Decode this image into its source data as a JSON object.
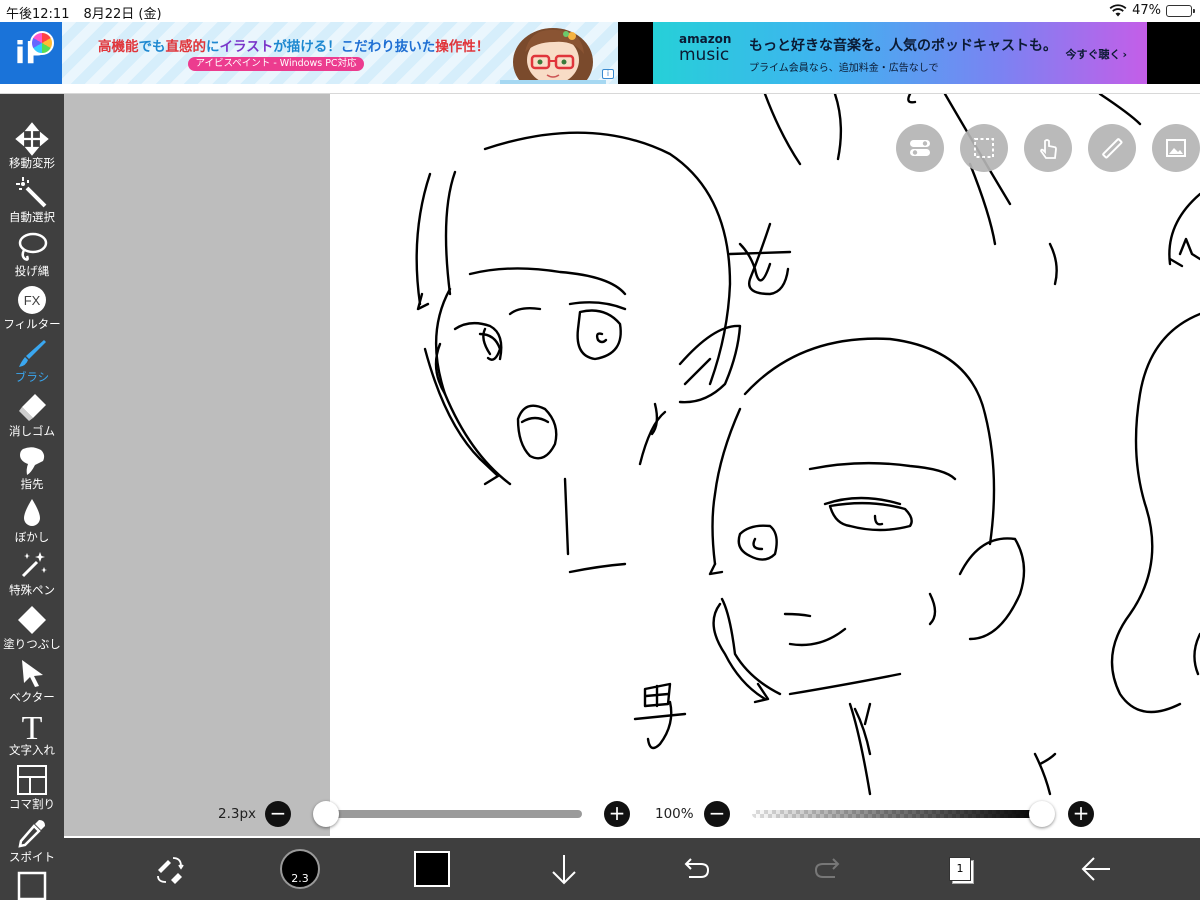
{
  "status_bar": {
    "time": "午後12:11",
    "date": "8月22日 (金)",
    "battery": "47%",
    "battery_level": 0.47
  },
  "ads": {
    "ibis": {
      "headline_parts": [
        "高機能",
        "でも",
        "直感的",
        "に",
        "イラスト",
        "が描ける！",
        "こだわり抜いた",
        "操作性！"
      ],
      "pill": "アイビスペイント - Windows PC対応",
      "info": "i"
    },
    "amazon": {
      "logo_word": "amazon",
      "logo_music": "music",
      "headline": "もっと好きな音楽を。人気のポッドキャストも。",
      "sub": "プライム会員なら、追加料金・広告なしで",
      "cta": "今すぐ聴く",
      "cta_arrow": "›"
    }
  },
  "app_logo": "iP",
  "tools": [
    {
      "label": "移動変形",
      "icon": "move-transform-icon"
    },
    {
      "label": "自動選択",
      "icon": "magic-wand-icon"
    },
    {
      "label": "投げ縄",
      "icon": "lasso-icon"
    },
    {
      "label": "フィルター",
      "icon": "filter-fx-icon",
      "glyph": "FX"
    },
    {
      "label": "ブラシ",
      "icon": "brush-icon",
      "active": true
    },
    {
      "label": "消しゴム",
      "icon": "eraser-icon"
    },
    {
      "label": "指先",
      "icon": "smudge-icon"
    },
    {
      "label": "ぼかし",
      "icon": "blur-drop-icon"
    },
    {
      "label": "特殊ペン",
      "icon": "special-pen-icon"
    },
    {
      "label": "塗りつぶし",
      "icon": "fill-bucket-icon"
    },
    {
      "label": "ベクター",
      "icon": "vector-arrow-icon"
    },
    {
      "label": "文字入れ",
      "icon": "text-icon",
      "glyph": "T"
    },
    {
      "label": "コマ割り",
      "icon": "frame-divider-icon"
    },
    {
      "label": "スポイト",
      "icon": "eyedropper-icon"
    },
    {
      "label": "",
      "icon": "canvas-icon"
    }
  ],
  "canvas_tools": [
    "toggle-icon",
    "selection-icon",
    "touch-icon",
    "ruler-icon",
    "reference-image-icon"
  ],
  "sketch_labels": {
    "female": "女",
    "male": "男"
  },
  "brush": {
    "size_label": "2.3px",
    "size_fraction": 0.0,
    "opacity_label": "100%",
    "opacity_fraction": 1.0,
    "minus": "−",
    "plus": "+"
  },
  "bottom_bar": {
    "brush_size_badge": "2.3",
    "color": "#000000",
    "layer_count": "1"
  },
  "colors": {
    "toolbar_bg": "#3f3f3f",
    "active_tool": "#3aa7f0",
    "canvas_backdrop": "#bdbdbd"
  }
}
